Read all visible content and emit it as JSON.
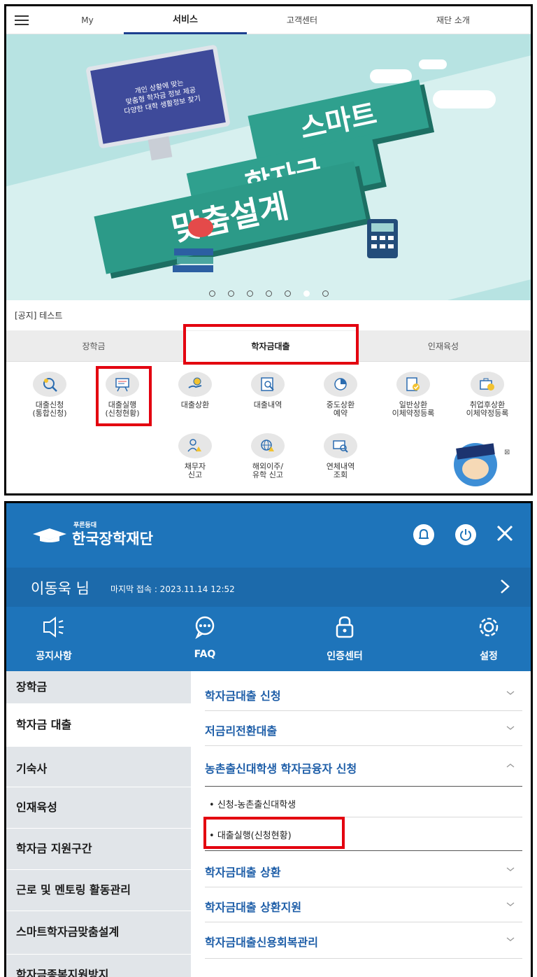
{
  "top_panel": {
    "nav": {
      "menu_icon": "hamburger-icon",
      "tabs": [
        {
          "label": "My"
        },
        {
          "label": "서비스",
          "active": true
        },
        {
          "label": "고객센터"
        },
        {
          "label": "재단 소개"
        }
      ]
    },
    "banner": {
      "monitor_text": "개인 상황에 맞는\n맞춤형 학자금 정보 제공\n다양한 대학 생활정보 찾기",
      "headline_lines": [
        "스마트",
        "학자금",
        "맞춤설계"
      ],
      "slide_count": 7,
      "active_slide": 6
    },
    "notice": "[공지] 테스트",
    "subtabs": [
      {
        "label": "장학금"
      },
      {
        "label": "학자금대출",
        "active": true
      },
      {
        "label": "인재육성"
      }
    ],
    "icons_row1": [
      {
        "label": "대출신청\n(통합신청)",
        "icon": "magnifier-coin-icon"
      },
      {
        "label": "대출실행\n(신청현황)",
        "icon": "presentation-board-icon",
        "highlighted": true
      },
      {
        "label": "대출상환",
        "icon": "hand-money-bag-icon"
      },
      {
        "label": "대출내역",
        "icon": "document-search-icon"
      },
      {
        "label": "중도상환\n예약",
        "icon": "pie-chart-icon"
      },
      {
        "label": "일반상환\n이체약정등록",
        "icon": "document-check-icon"
      },
      {
        "label": "취업후상환\n이체약정등록",
        "icon": "briefcase-check-icon"
      }
    ],
    "icons_row2": [
      {
        "label": "채무자\n신고",
        "icon": "person-alert-icon"
      },
      {
        "label": "해외이주/\n유학 신고",
        "icon": "globe-alert-icon"
      },
      {
        "label": "연체내역\n조회",
        "icon": "card-search-icon"
      }
    ],
    "chatbot": {
      "icon": "mascot-chatbot-icon",
      "close_icon": "close-small-icon"
    }
  },
  "bottom_panel": {
    "logo": {
      "small": "푸른등대",
      "name": "한국장학재단"
    },
    "header_icons": [
      "bell-icon",
      "power-icon",
      "close-icon"
    ],
    "user": {
      "name": "이동욱 님",
      "last_login": "마지막 접속 : 2023.11.14 12:52"
    },
    "quick_links": [
      {
        "label": "공지사항",
        "icon": "megaphone-icon"
      },
      {
        "label": "FAQ",
        "icon": "chat-bubble-icon"
      },
      {
        "label": "인증센터",
        "icon": "lock-icon"
      },
      {
        "label": "설정",
        "icon": "gear-icon"
      }
    ],
    "left_menu": [
      {
        "label": "장학금"
      },
      {
        "label": "학자금 대출",
        "active": true
      },
      {
        "label": "기숙사"
      },
      {
        "label": "인재육성"
      },
      {
        "label": "학자금 지원구간"
      },
      {
        "label": "근로 및 멘토링 활동관리"
      },
      {
        "label": "스마트학자금맞춤설계"
      },
      {
        "label": "학자금종복지원방지"
      }
    ],
    "right_menu": [
      {
        "label": "학자금대출 신청",
        "expanded": false
      },
      {
        "label": "저금리전환대출",
        "expanded": false
      },
      {
        "label": "농촌출신대학생 학자금융자 신청",
        "expanded": true,
        "children": [
          {
            "label": "신청-농촌출신대학생"
          },
          {
            "label": "대출실행(신청현황)",
            "highlighted": true
          }
        ]
      },
      {
        "label": "학자금대출 상환",
        "expanded": false
      },
      {
        "label": "학자금대출 상환지원",
        "expanded": false
      },
      {
        "label": "학자금대출신용회복관리",
        "expanded": false
      }
    ],
    "colors": {
      "header_blue": "#1e74ba",
      "link_blue": "#1e5ea8",
      "highlight_red": "#e3000f"
    }
  }
}
